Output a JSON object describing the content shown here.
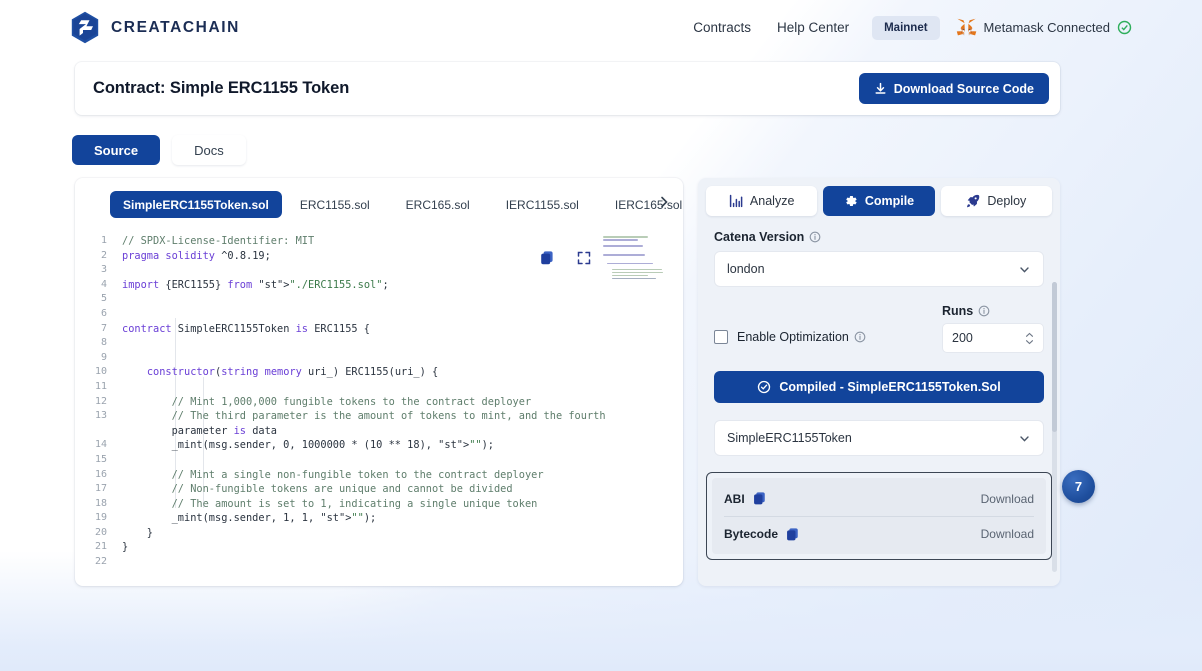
{
  "header": {
    "brand_name": "CREATACHAIN",
    "logo_icon": "creatachain-hexagon-logo",
    "nav": [
      {
        "label": "Contracts",
        "name": "nav-contracts"
      },
      {
        "label": "Help Center",
        "name": "nav-help-center"
      }
    ],
    "network_badge": "Mainnet",
    "wallet_text": "Metamask Connected",
    "wallet_icon": "metamask-fox-icon",
    "wallet_status_icon": "check-circle-icon",
    "accent_color": "#12449b"
  },
  "contract_bar": {
    "title": "Contract: Simple ERC1155 Token",
    "download_label": "Download Source Code",
    "download_icon": "download-icon"
  },
  "view_tabs": [
    {
      "label": "Source",
      "active": true
    },
    {
      "label": "Docs",
      "active": false
    }
  ],
  "source_panel": {
    "file_tabs": [
      {
        "label": "SimpleERC1155Token.sol",
        "active": true
      },
      {
        "label": "ERC1155.sol",
        "active": false
      },
      {
        "label": "ERC165.sol",
        "active": false
      },
      {
        "label": "IERC1155.sol",
        "active": false
      },
      {
        "label": "IERC165.sol",
        "active": false
      }
    ],
    "tabs_next_icon": "chevron-right-icon",
    "copy_icon": "copy-icon",
    "expand_icon": "expand-fullscreen-icon",
    "line_numbers": [
      "1",
      "2",
      "3",
      "4",
      "5",
      "6",
      "7",
      "8",
      "9",
      "10",
      "11",
      "12",
      "13",
      "",
      "14",
      "15",
      "16",
      "17",
      "18",
      "19",
      "20",
      "21",
      "22"
    ],
    "code_lines": [
      "// SPDX-License-Identifier: MIT",
      "pragma solidity ^0.8.19;",
      "",
      "import {ERC1155} from \"./ERC1155.sol\";",
      "",
      "",
      "contract SimpleERC1155Token is ERC1155 {",
      "",
      "",
      "    constructor(string memory uri_) ERC1155(uri_) {",
      "",
      "        // Mint 1,000,000 fungible tokens to the contract deployer",
      "        // The third parameter is the amount of tokens to mint, and the fourth",
      "        parameter is data",
      "        _mint(msg.sender, 0, 1000000 * (10 ** 18), \"\");",
      "",
      "        // Mint a single non-fungible token to the contract deployer",
      "        // Non-fungible tokens are unique and cannot be divided",
      "        // The amount is set to 1, indicating a single unique token",
      "        _mint(msg.sender, 1, 1, \"\");",
      "    }",
      "}",
      ""
    ]
  },
  "right_panel": {
    "mode_tabs": [
      {
        "label": "Analyze",
        "icon": "analyze-chart-icon",
        "active": false
      },
      {
        "label": "Compile",
        "icon": "gear-icon",
        "active": true
      },
      {
        "label": "Deploy",
        "icon": "rocket-icon",
        "active": false
      }
    ],
    "catena_version_label": "Catena Version",
    "catena_version_value": "london",
    "optimization_label": "Enable Optimization",
    "optimization_checked": false,
    "runs_label": "Runs",
    "runs_value": "200",
    "compiled_button_label": "Compiled - SimpleERC1155Token.Sol",
    "compiled_button_icon": "check-circle-icon",
    "contract_select_value": "SimpleERC1155Token",
    "artifacts": [
      {
        "name": "ABI",
        "copy_icon": "copy-icon",
        "download_label": "Download"
      },
      {
        "name": "Bytecode",
        "copy_icon": "copy-icon",
        "download_label": "Download"
      }
    ]
  },
  "step_badge": "7"
}
